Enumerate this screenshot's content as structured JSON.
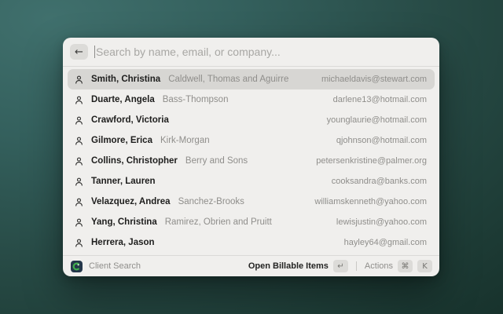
{
  "window": {
    "search": {
      "placeholder": "Search by name, email, or company...",
      "back_icon": "←"
    },
    "results": [
      {
        "name": "Smith, Christina",
        "company": "Caldwell, Thomas and Aguirre",
        "email": "michaeldavis@stewart.com",
        "selected": true
      },
      {
        "name": "Duarte, Angela",
        "company": "Bass-Thompson",
        "email": "darlene13@hotmail.com",
        "selected": false
      },
      {
        "name": "Crawford, Victoria",
        "company": "",
        "email": "younglaurie@hotmail.com",
        "selected": false
      },
      {
        "name": "Gilmore, Erica",
        "company": "Kirk-Morgan",
        "email": "qjohnson@hotmail.com",
        "selected": false
      },
      {
        "name": "Collins, Christopher",
        "company": "Berry and Sons",
        "email": "petersenkristine@palmer.org",
        "selected": false
      },
      {
        "name": "Tanner, Lauren",
        "company": "",
        "email": "cooksandra@banks.com",
        "selected": false
      },
      {
        "name": "Velazquez, Andrea",
        "company": "Sanchez-Brooks",
        "email": "williamskenneth@yahoo.com",
        "selected": false
      },
      {
        "name": "Yang, Christina",
        "company": "Ramirez, Obrien and Pruitt",
        "email": "lewisjustin@yahoo.com",
        "selected": false
      },
      {
        "name": "Herrera, Jason",
        "company": "",
        "email": "hayley64@gmail.com",
        "selected": false
      }
    ],
    "footer": {
      "app_name": "Client Search",
      "primary_action": "Open Billable Items",
      "primary_key": "↵",
      "secondary_action": "Actions",
      "secondary_key_1": "⌘",
      "secondary_key_2": "K"
    }
  },
  "colors": {
    "background_top_left": "#40706d",
    "background_bottom_right": "#16302a",
    "window_bg": "#f0efed",
    "selected_row_bg": "#d7d6d3",
    "muted_text": "#8f8e8b",
    "app_icon_green": "#3fae4c"
  }
}
